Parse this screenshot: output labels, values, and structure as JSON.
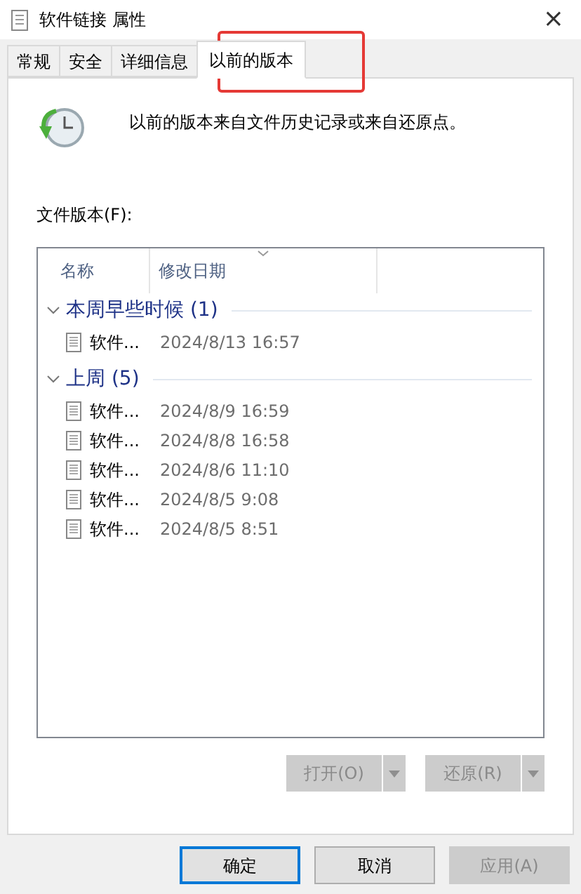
{
  "window": {
    "title": "软件链接 属性",
    "close": "×"
  },
  "tabs": [
    {
      "label": "常规",
      "selected": false
    },
    {
      "label": "安全",
      "selected": false
    },
    {
      "label": "详细信息",
      "selected": false
    },
    {
      "label": "以前的版本",
      "selected": true
    }
  ],
  "description": "以前的版本来自文件历史记录或来自还原点。",
  "list_label": "文件版本(F):",
  "table": {
    "columns": [
      "名称",
      "修改日期"
    ],
    "groups": [
      {
        "title": "本周早些时候 (1)",
        "expanded": true,
        "rows": [
          {
            "name": "软件...",
            "date": "2024/8/13 16:57"
          }
        ]
      },
      {
        "title": "上周 (5)",
        "expanded": true,
        "rows": [
          {
            "name": "软件...",
            "date": "2024/8/9 16:59"
          },
          {
            "name": "软件...",
            "date": "2024/8/8 16:58"
          },
          {
            "name": "软件...",
            "date": "2024/8/6 11:10"
          },
          {
            "name": "软件...",
            "date": "2024/8/5 9:08"
          },
          {
            "name": "软件...",
            "date": "2024/8/5 8:51"
          }
        ]
      }
    ]
  },
  "actions": [
    {
      "label": "打开(O)",
      "disabled": true
    },
    {
      "label": "还原(R)",
      "disabled": true
    }
  ],
  "buttons": [
    {
      "label": "确定",
      "disabled": false,
      "default": true
    },
    {
      "label": "取消",
      "disabled": false,
      "default": false
    },
    {
      "label": "应用(A)",
      "disabled": true,
      "default": false
    }
  ]
}
